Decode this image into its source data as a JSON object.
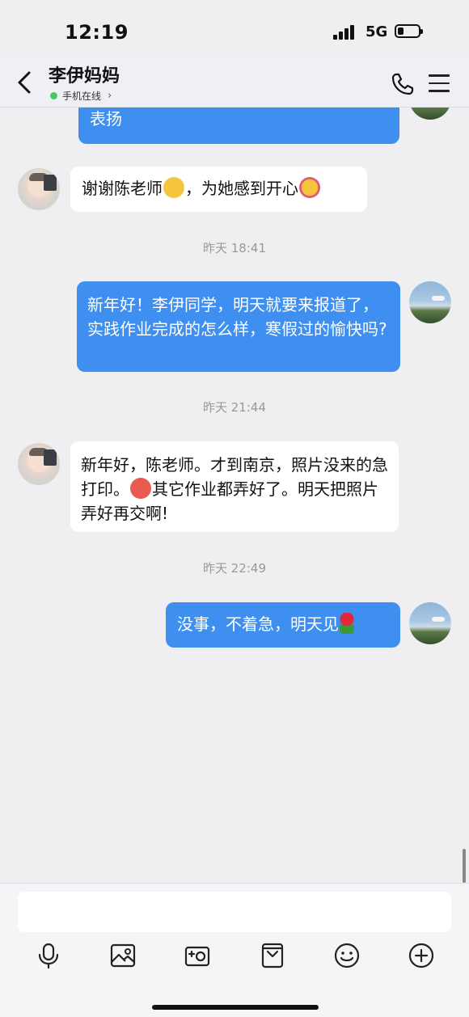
{
  "status": {
    "time": "12:19",
    "network": "5G"
  },
  "header": {
    "title": "李伊妈妈",
    "presence": "手机在线"
  },
  "messages": [
    {
      "from": "out",
      "text_top": "表扬"
    },
    {
      "from": "in",
      "text": "谢谢陈老师",
      "text_b": "，为她感到开心"
    },
    {
      "timestamp": "昨天 18:41"
    },
    {
      "from": "out",
      "text": "新年好！李伊同学，明天就要来报道了，实践作业完成的怎么样，寒假过的愉快吗?"
    },
    {
      "timestamp": "昨天 21:44"
    },
    {
      "from": "in",
      "text": "新年好，陈老师。才到南京，照片没来的急打印。",
      "text_b": "其它作业都弄好了。明天把照片弄好再交啊!"
    },
    {
      "timestamp": "昨天 22:49"
    },
    {
      "from": "out",
      "text": "没事，不着急，明天见"
    }
  ],
  "toolbar": {
    "icons": [
      "microphone-icon",
      "image-icon",
      "camera-icon",
      "file-icon",
      "emoji-icon",
      "plus-icon"
    ]
  },
  "colors": {
    "outgoing_bubble": "#3f8ff0",
    "incoming_bubble": "#ffffff",
    "background": "#efeff2",
    "online": "#48c766"
  }
}
